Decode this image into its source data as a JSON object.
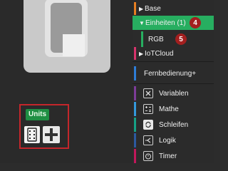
{
  "units_panel": {
    "badge_label": "Units",
    "icons": [
      "rgb-unit-icon",
      "add-unit-icon"
    ]
  },
  "sidebar": {
    "items": [
      {
        "label": "Base",
        "color": "#e67e22"
      },
      {
        "label": "Einheiten (1)",
        "color": "#27ae60",
        "badge": "4"
      },
      {
        "label": "RGB",
        "color": "#27ae60",
        "badge": "5"
      },
      {
        "label": "IoTCloud",
        "color": "#d6336c"
      },
      {
        "label": "Fernbedienung+",
        "color": "#2e7dd7"
      },
      {
        "label": "Variablen",
        "color": "#7d3c98",
        "icon": "variable-icon"
      },
      {
        "label": "Mathe",
        "color": "#3498db",
        "icon": "math-icon"
      },
      {
        "label": "Schleifen",
        "color": "#16a085",
        "icon": "loop-icon"
      },
      {
        "label": "Logik",
        "color": "#2c5aa0",
        "icon": "logic-icon"
      },
      {
        "label": "Timer",
        "color": "#c2185b",
        "icon": "timer-icon"
      }
    ]
  }
}
